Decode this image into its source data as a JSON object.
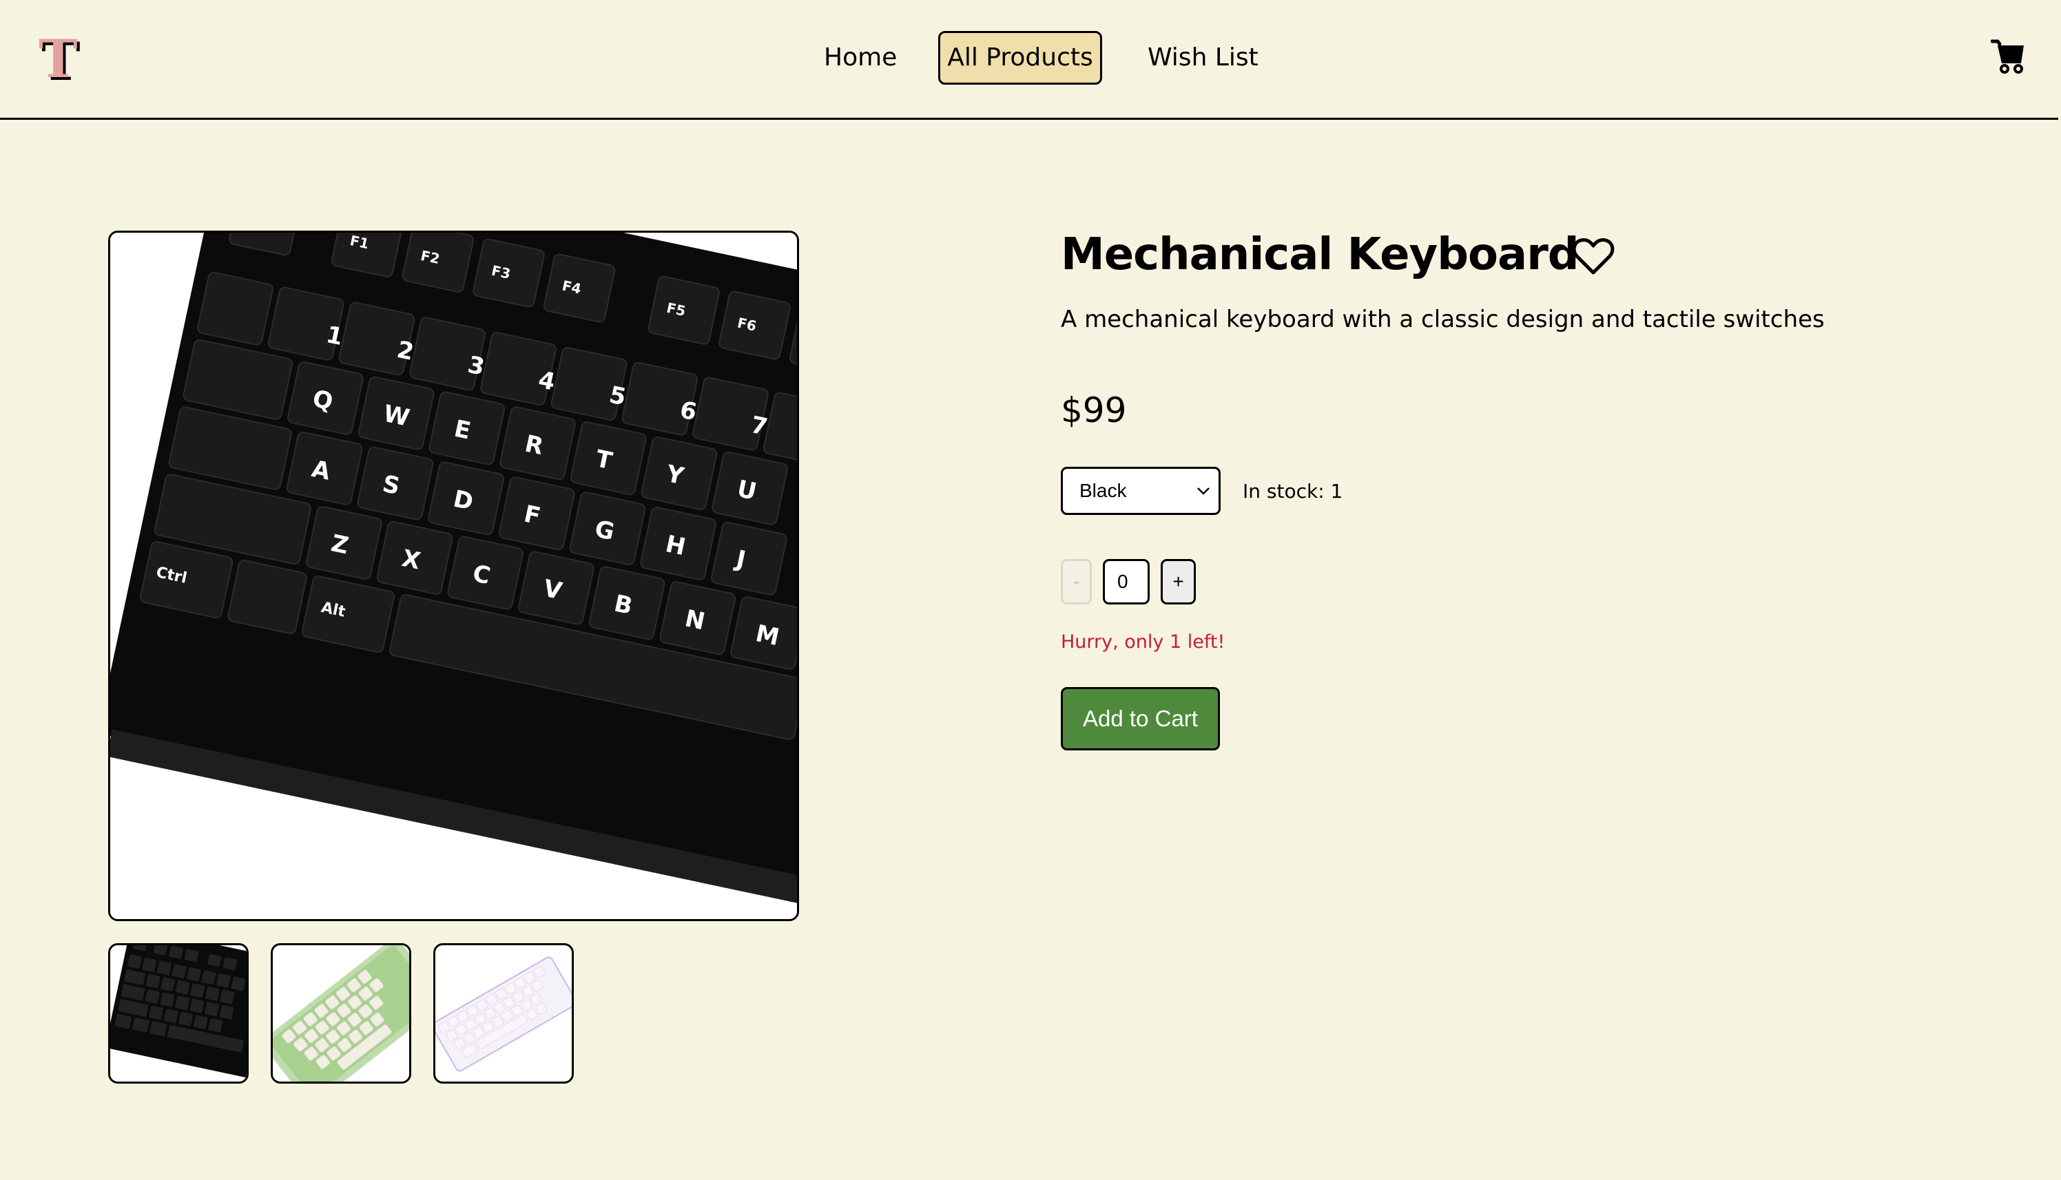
{
  "header": {
    "logo_text": "T",
    "nav": [
      {
        "label": "Home",
        "active": false
      },
      {
        "label": "All Products",
        "active": true
      },
      {
        "label": "Wish List",
        "active": false
      }
    ],
    "cart_icon": "shopping-cart-icon"
  },
  "colors": {
    "background": "#f7f3e1",
    "nav_active_bg": "#f0dfaa",
    "logo": "#e4a2a0",
    "add_to_cart_bg": "#4f8a3c",
    "warning_text": "#c41e2e"
  },
  "product": {
    "title": "Mechanical Keyboard",
    "description": "A mechanical keyboard with a classic design and tactile switches",
    "price": "$99",
    "wishlist_icon": "heart-outline-icon",
    "variant": {
      "selected": "Black"
    },
    "stock_text": "In stock: 1",
    "quantity": {
      "decrement_label": "-",
      "value": "0",
      "increment_label": "+"
    },
    "warning": "Hurry, only 1 left!",
    "add_to_cart_label": "Add to Cart",
    "images": {
      "main": "black mechanical keyboard",
      "thumbnails": [
        {
          "alt": "black mechanical keyboard"
        },
        {
          "alt": "green and cream mechanical keyboard"
        },
        {
          "alt": "white RGB mechanical keyboard"
        }
      ]
    }
  }
}
